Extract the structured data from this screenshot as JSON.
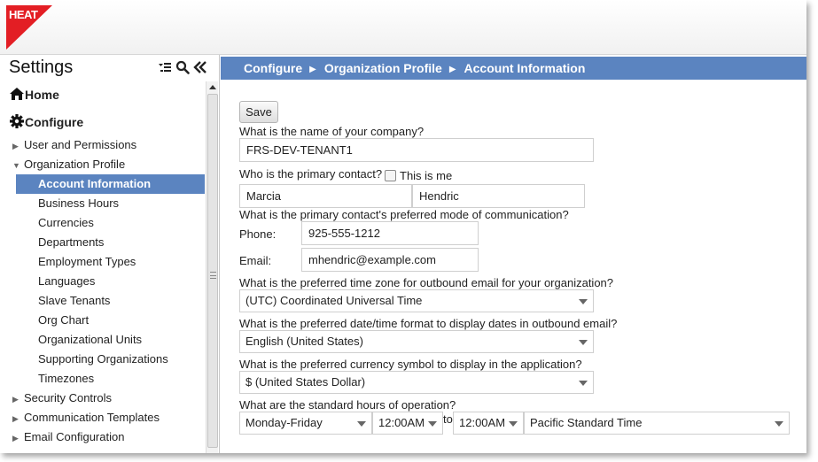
{
  "app": {
    "logo_text": "HEAT",
    "brand_color": "#e31e24",
    "accent_color": "#5b84c0"
  },
  "sidebar": {
    "title": "Settings",
    "tools": [
      "collapse-list-icon",
      "search-icon",
      "double-chevron-left-icon"
    ],
    "items": [
      {
        "label": "Home",
        "icon": "home-icon",
        "level": 0
      },
      {
        "label": "Configure",
        "icon": "gear-icon",
        "level": 0
      },
      {
        "label": "User and Permissions",
        "level": 1,
        "expanded": false
      },
      {
        "label": "Organization Profile",
        "level": 1,
        "expanded": true
      },
      {
        "label": "Account Information",
        "level": 2,
        "selected": true
      },
      {
        "label": "Business Hours",
        "level": 2
      },
      {
        "label": "Currencies",
        "level": 2
      },
      {
        "label": "Departments",
        "level": 2
      },
      {
        "label": "Employment Types",
        "level": 2
      },
      {
        "label": "Languages",
        "level": 2
      },
      {
        "label": "Slave Tenants",
        "level": 2
      },
      {
        "label": "Org Chart",
        "level": 2
      },
      {
        "label": "Organizational Units",
        "level": 2
      },
      {
        "label": "Supporting Organizations",
        "level": 2
      },
      {
        "label": "Timezones",
        "level": 2
      },
      {
        "label": "Security Controls",
        "level": 1,
        "expanded": false
      },
      {
        "label": "Communication Templates",
        "level": 1,
        "expanded": false
      },
      {
        "label": "Email Configuration",
        "level": 1,
        "expanded": false
      }
    ]
  },
  "breadcrumb": [
    "Configure",
    "Organization Profile",
    "Account Information"
  ],
  "form": {
    "save_label": "Save",
    "company_question": "What is the name of your company?",
    "company_value": "FRS-DEV-TENANT1",
    "contact_question": "Who is the primary contact?",
    "this_is_me_label": "This is me",
    "this_is_me_checked": false,
    "first_name": "Marcia",
    "last_name": "Hendric",
    "comm_question": "What is the primary contact's preferred mode of communication?",
    "phone_label": "Phone:",
    "phone_value": "925-555-1212",
    "email_label": "Email:",
    "email_value": "mhendric@example.com",
    "timezone_question": "What is the preferred time zone for outbound email for your organization?",
    "timezone_value": "(UTC) Coordinated Universal Time",
    "datetime_question": "What is the preferred date/time format to display dates in outbound email?",
    "datetime_value": "English (United States)",
    "currency_question": "What is the preferred currency symbol to display in the application?",
    "currency_value": "$ (United States Dollar)",
    "hours_question": "What are the standard hours of operation?",
    "days_value": "Monday-Friday",
    "start_time": "12:00AM",
    "to_label": "to",
    "end_time": "12:00AM",
    "hours_timezone": "Pacific Standard Time"
  }
}
